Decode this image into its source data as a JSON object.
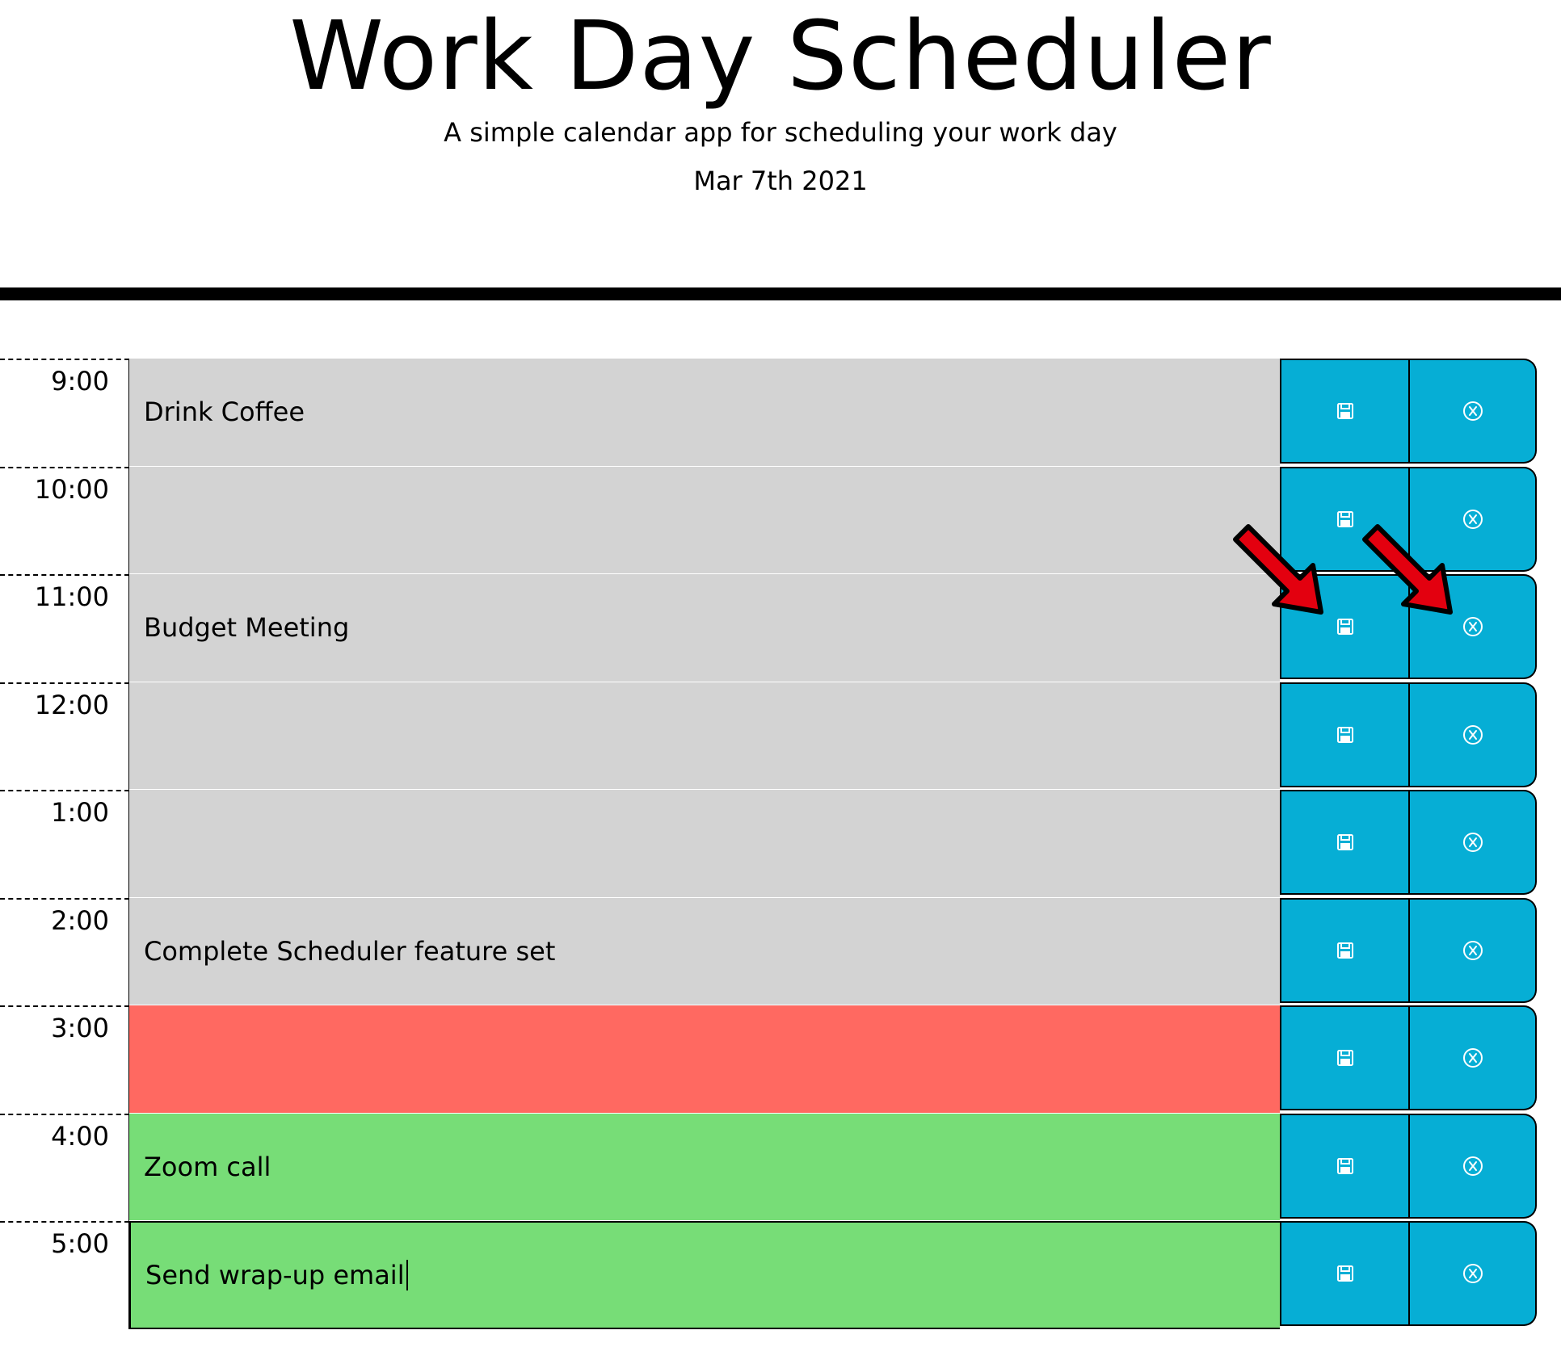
{
  "header": {
    "title": "Work Day Scheduler",
    "subtitle": "A simple calendar app for scheduling your work day",
    "current_day": "Mar 7th 2021"
  },
  "colors": {
    "past": "#d3d3d3",
    "present": "#ff6961",
    "future": "#77dd77",
    "button": "#06aed5",
    "annotation_arrow": "#e3000f"
  },
  "time_blocks": [
    {
      "hour": "9:00",
      "event": "Drink Coffee",
      "state": "past"
    },
    {
      "hour": "10:00",
      "event": "",
      "state": "past"
    },
    {
      "hour": "11:00",
      "event": "Budget Meeting",
      "state": "past"
    },
    {
      "hour": "12:00",
      "event": "",
      "state": "past"
    },
    {
      "hour": "1:00",
      "event": "",
      "state": "past"
    },
    {
      "hour": "2:00",
      "event": "Complete Scheduler feature set",
      "state": "past"
    },
    {
      "hour": "3:00",
      "event": "",
      "state": "present"
    },
    {
      "hour": "4:00",
      "event": "Zoom call",
      "state": "future"
    },
    {
      "hour": "5:00",
      "event": "Send wrap-up email",
      "state": "future"
    }
  ],
  "icons": {
    "save": "floppy-disk-icon",
    "clear": "circle-x-icon"
  }
}
